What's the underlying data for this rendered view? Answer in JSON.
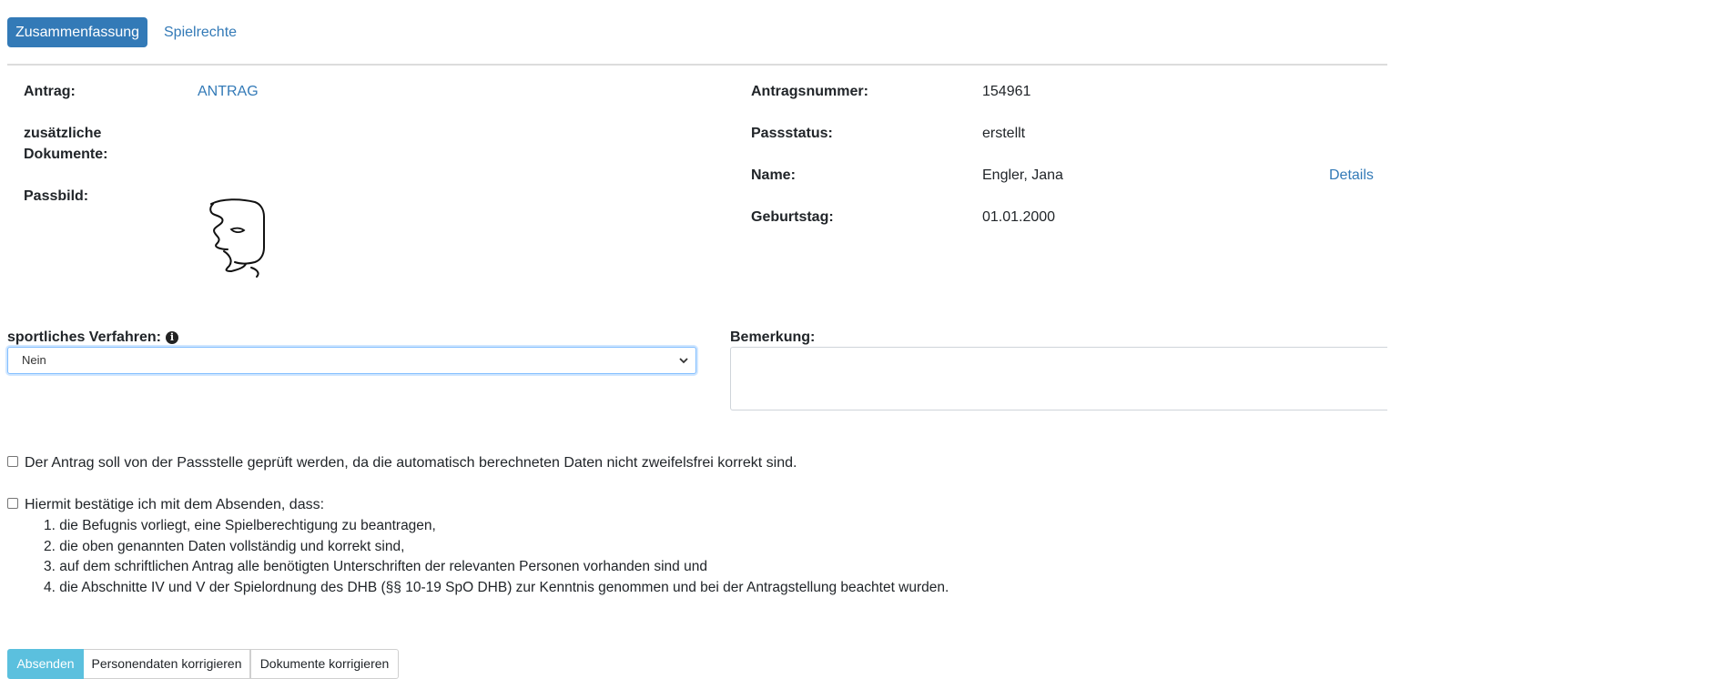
{
  "tabs": [
    {
      "label": "Zusammenfassung",
      "active": true
    },
    {
      "label": "Spielrechte",
      "active": false
    }
  ],
  "left_info": {
    "antrag_label": "Antrag:",
    "antrag_link": "ANTRAG",
    "zusatz_label_line1": "zusätzliche",
    "zusatz_label_line2": "Dokumente:",
    "passbild_label": "Passbild:"
  },
  "right_info": {
    "antragsnummer_label": "Antragsnummer:",
    "antragsnummer_value": "154961",
    "passstatus_label": "Passstatus:",
    "passstatus_value": "erstellt",
    "name_label": "Name:",
    "name_value": "Engler, Jana",
    "details_link": "Details",
    "geburtstag_label": "Geburtstag:",
    "geburtstag_value": "01.01.2000"
  },
  "form": {
    "verfahren_label": "sportliches Verfahren:",
    "verfahren_selected": "Nein",
    "bemerkung_label": "Bemerkung:",
    "bemerkung_value": ""
  },
  "checkboxes": {
    "pruefung_text": "Der Antrag soll von der Passstelle geprüft werden, da die automatisch berechneten Daten nicht zweifelsfrei korrekt sind.",
    "bestaetigung_text": "Hiermit bestätige ich mit dem Absenden, dass:",
    "bestaetigung_items": [
      "1. die Befugnis vorliegt, eine Spielberechtigung zu beantragen,",
      "2. die oben genannten Daten vollständig und korrekt sind,",
      "3. auf dem schriftlichen Antrag alle benötigten Unterschriften der relevanten Personen vorhanden sind und",
      "4. die Abschnitte IV und V der Spielordnung des DHB (§§ 10-19 SpO DHB) zur Kenntnis genommen und bei der Antragstellung beachtet wurden."
    ]
  },
  "buttons": {
    "submit": "Absenden",
    "correct_person": "Personendaten korrigieren",
    "correct_docs": "Dokumente korrigieren"
  },
  "colors": {
    "primary": "#337ab7",
    "info_button": "#5bc0de",
    "select_focus": "#80bdff"
  }
}
